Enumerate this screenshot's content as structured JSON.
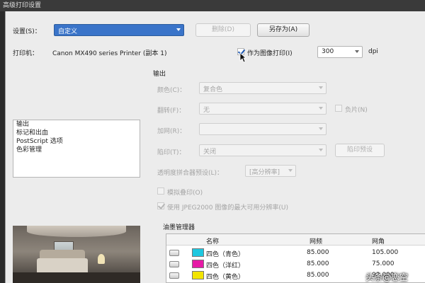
{
  "window": {
    "title": "高级打印设置"
  },
  "settings": {
    "label": "设置(S)：",
    "preset_value": "自定义",
    "delete_label": "删除(D)",
    "save_as_label": "另存为(A)"
  },
  "printer": {
    "label": "打印机：",
    "name": "Canon MX490 series Printer (副本 1)",
    "print_as_image_label": "作为图像打印(I)",
    "print_as_image_checked": true,
    "dpi_value": "300",
    "dpi_unit": "dpi"
  },
  "sidebar": {
    "items": [
      {
        "label": "输出",
        "selected": true
      },
      {
        "label": "标记和出血"
      },
      {
        "label": "PostScript 选项"
      },
      {
        "label": "色彩管理"
      }
    ]
  },
  "output": {
    "section_title": "输出",
    "color_label": "颜色(C)：",
    "color_value": "复合色",
    "flip_label": "翻转(F)：",
    "flip_value": "无",
    "negative_label": "负片(N)",
    "screening_label": "加网(R)：",
    "screening_value": "",
    "trapping_label": "陷印(T)：",
    "trapping_value": "关闭",
    "trap_presets_label": "陷印预设",
    "flattener_label": "透明度拼合器预设(L)：",
    "flattener_value": "[高分辨率]",
    "simulate_overprint_label": "模拟叠印(O)",
    "jpeg2000_label": "使用 JPEG2000 图像的最大可用分辨率(U)",
    "jpeg2000_checked": true
  },
  "ink_manager": {
    "title": "油墨管理器",
    "columns": [
      "名称",
      "网频",
      "网角"
    ],
    "rows": [
      {
        "name": "四色（青色）",
        "frequency": "85.000",
        "angle": "105.000",
        "color": "#1ec8e0"
      },
      {
        "name": "四色（洋红）",
        "frequency": "85.000",
        "angle": "75.000",
        "color": "#e61aa6"
      },
      {
        "name": "四色（黄色）",
        "frequency": "85.000",
        "angle": "90.000",
        "color": "#f2e400"
      }
    ]
  },
  "watermark": {
    "text": "头条@恋空"
  }
}
